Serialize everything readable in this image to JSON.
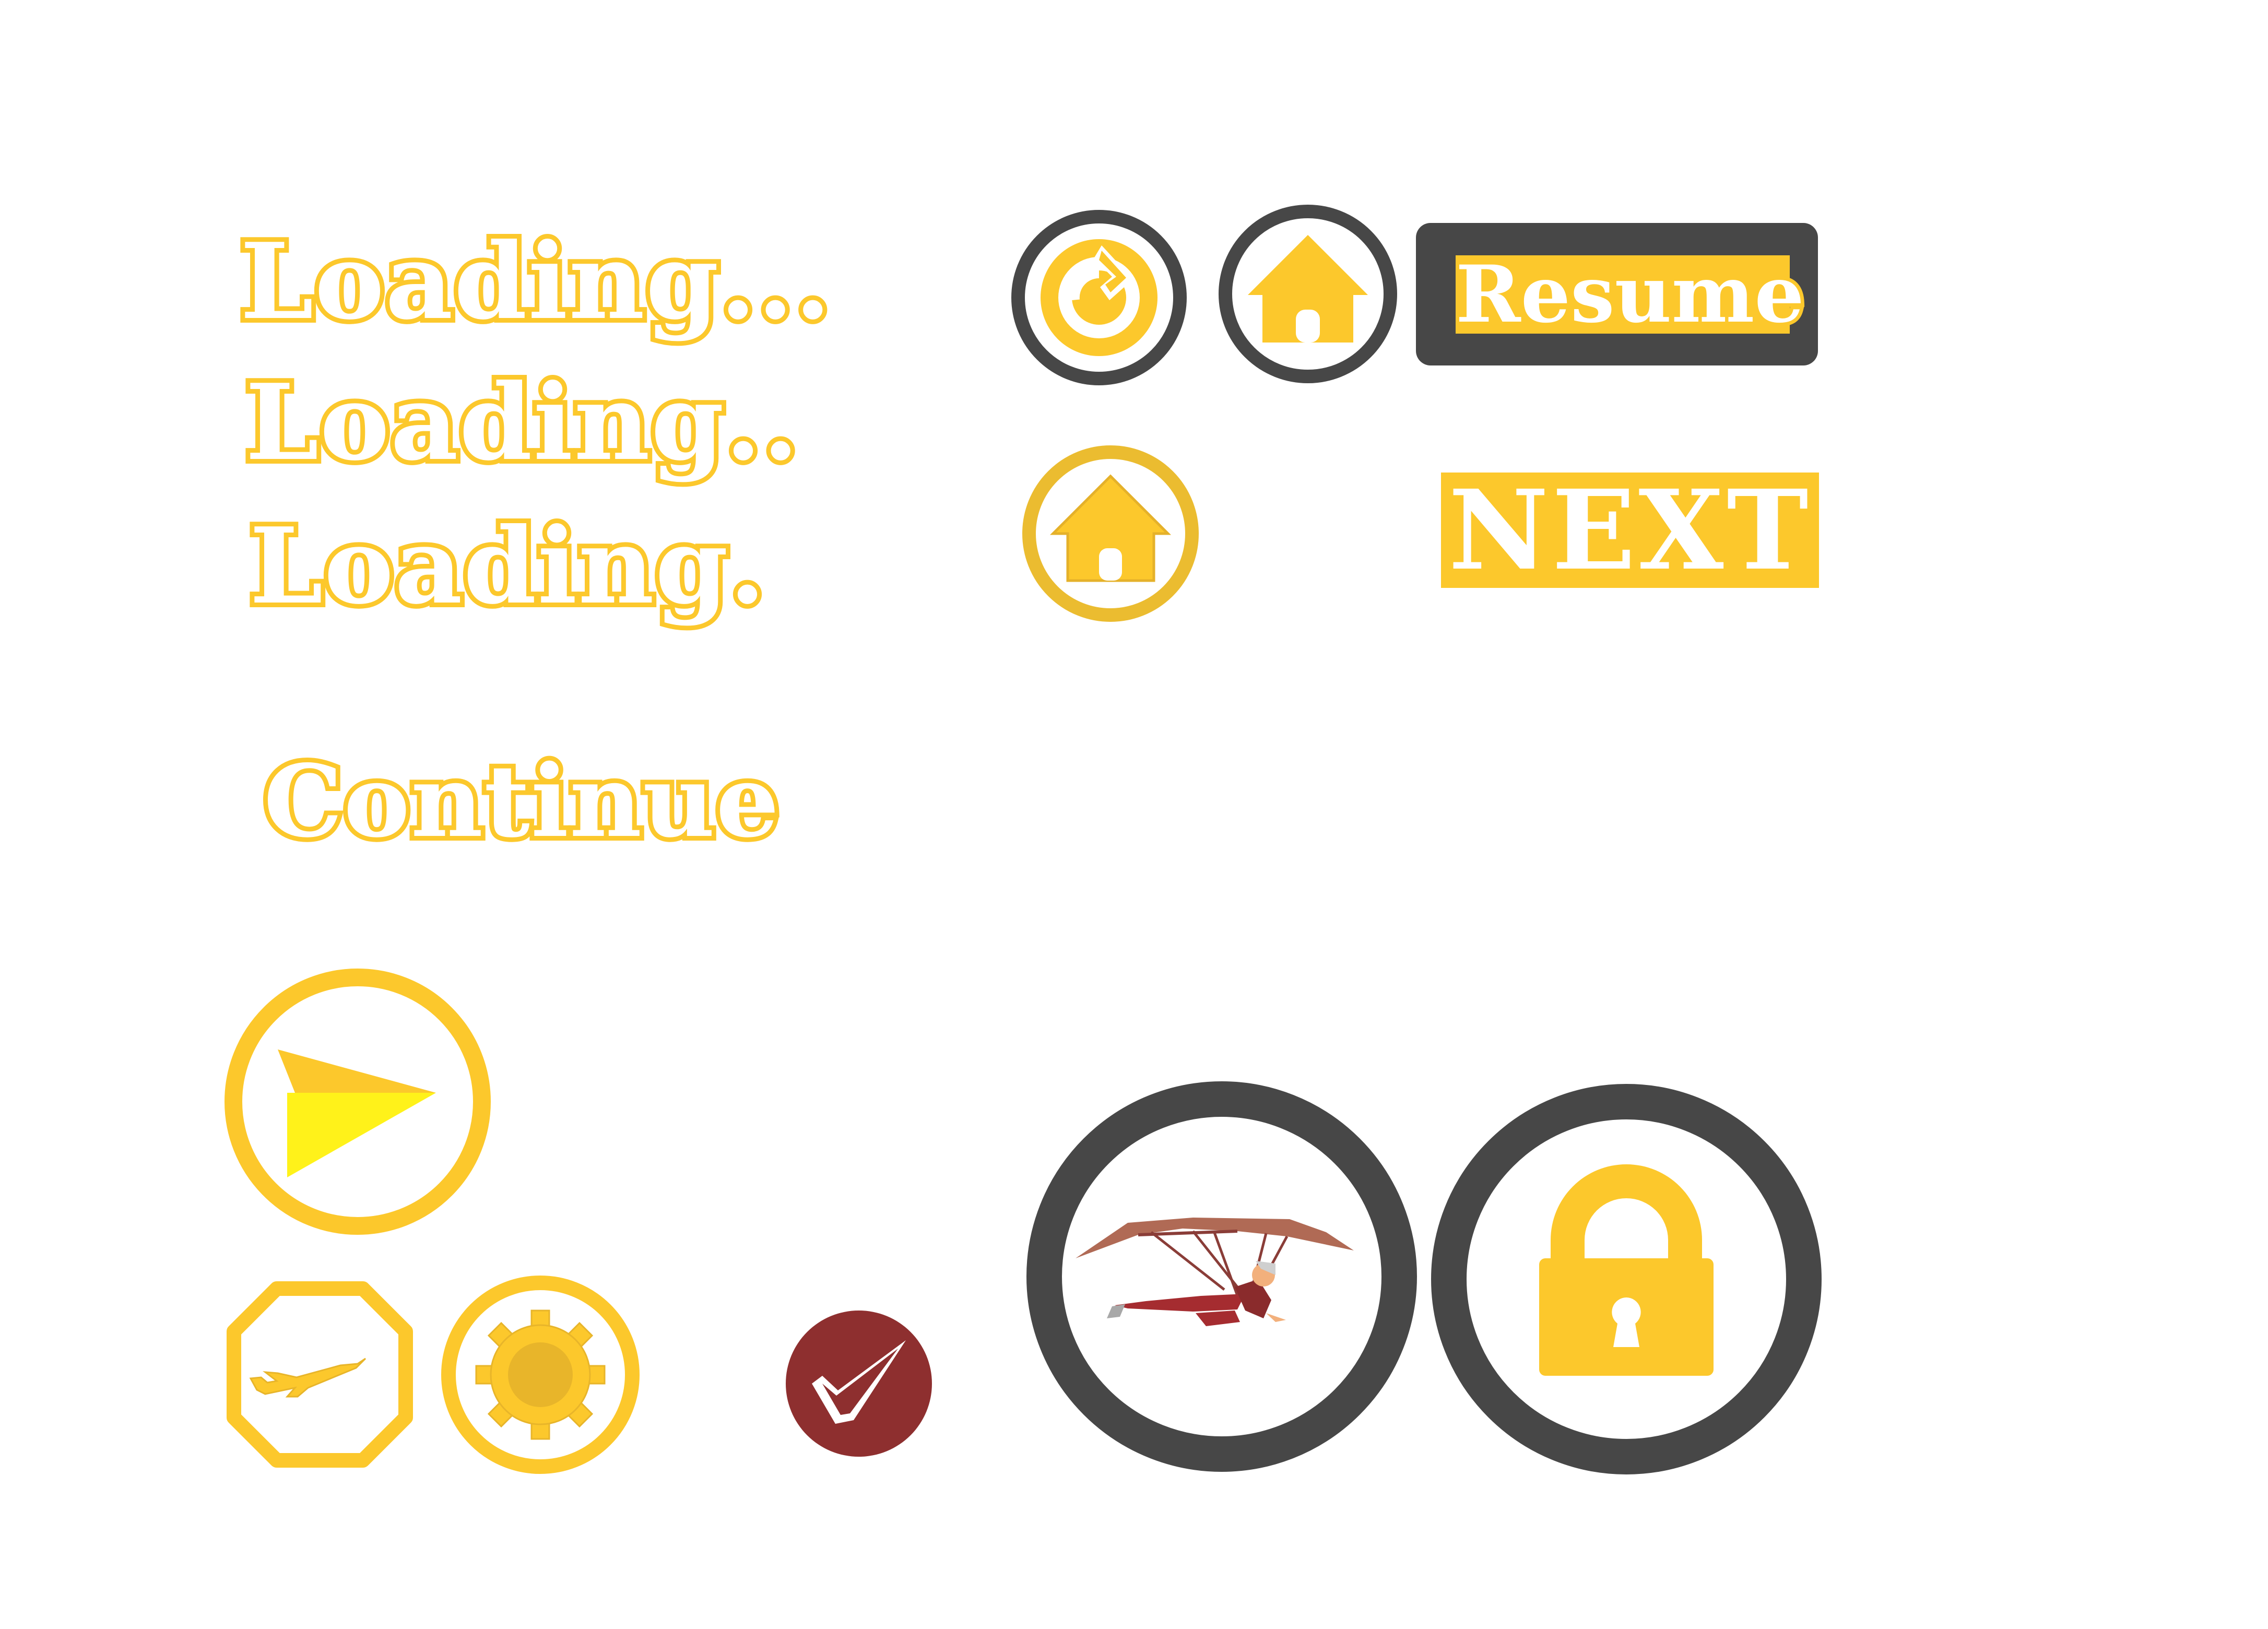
{
  "loading_labels": {
    "three_dots": "Loading...",
    "two_dots": "Loading..",
    "one_dot": "Loading."
  },
  "continue_label": "Continue",
  "resume_button": {
    "label": "Resume"
  },
  "next_button": {
    "label": "NEXT"
  },
  "icons": {
    "restart": "restart-icon",
    "home_dark": "home-icon",
    "home_gold": "home-icon",
    "play": "play-arrow-icon",
    "airplane": "airplane-icon",
    "settings": "gear-icon",
    "check": "checkmark-icon",
    "hang_glider": "hang-glider-icon",
    "lock": "padlock-icon"
  },
  "colors": {
    "accent_yellow": "#fcc82c",
    "dark_gray": "#474747",
    "check_red": "#8e2f2f",
    "play_bright_yellow": "#fff21a"
  }
}
